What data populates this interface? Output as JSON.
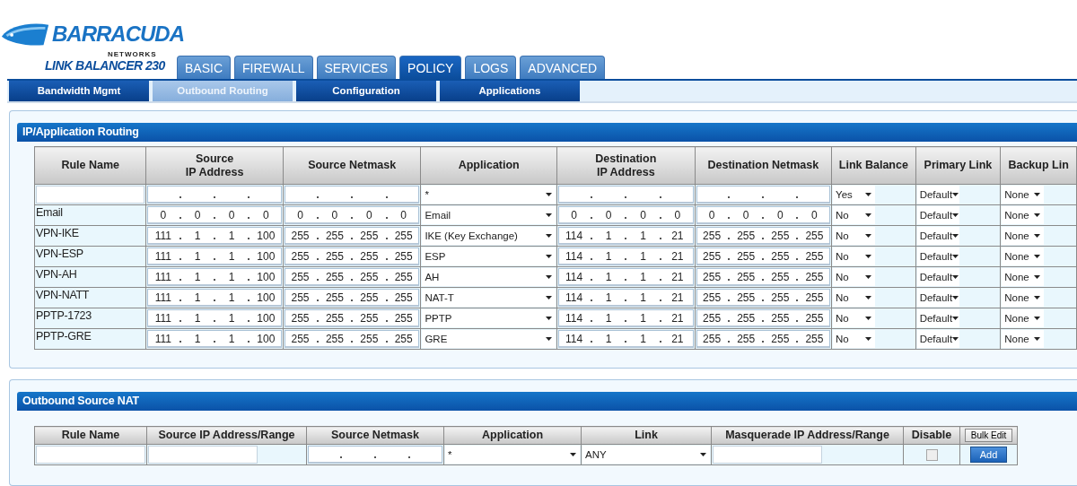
{
  "logo": {
    "brand": "BARRACUDA",
    "tagline": "NETWORKS",
    "product": "LINK BALANCER 230"
  },
  "tabs": [
    {
      "label": "BASIC",
      "selected": false
    },
    {
      "label": "FIREWALL",
      "selected": false
    },
    {
      "label": "SERVICES",
      "selected": false
    },
    {
      "label": "POLICY",
      "selected": true
    },
    {
      "label": "LOGS",
      "selected": false
    },
    {
      "label": "ADVANCED",
      "selected": false
    }
  ],
  "subtabs": [
    {
      "label": "Bandwidth Mgmt",
      "selected": false
    },
    {
      "label": "Outbound Routing",
      "selected": true
    },
    {
      "label": "Configuration",
      "selected": false
    },
    {
      "label": "Applications",
      "selected": false
    }
  ],
  "routing": {
    "title": "IP/Application Routing",
    "columns": [
      {
        "label": "Rule Name",
        "kind": "text"
      },
      {
        "label": "Source\nIP Address",
        "kind": "ip"
      },
      {
        "label": "Source Netmask",
        "kind": "ip"
      },
      {
        "label": "Application",
        "kind": "select"
      },
      {
        "label": "Destination\nIP Address",
        "kind": "ip"
      },
      {
        "label": "Destination Netmask",
        "kind": "ip"
      },
      {
        "label": "Link Balance",
        "kind": "select-short"
      },
      {
        "label": "Primary Link",
        "kind": "select-short"
      },
      {
        "label": "Backup Lin",
        "kind": "select-short"
      }
    ],
    "rows": [
      {
        "cells": [
          null,
          null,
          null,
          "*",
          null,
          null,
          "Yes",
          "Default",
          "None"
        ]
      },
      {
        "cells": [
          "Email",
          [
            "0",
            "0",
            "0",
            "0"
          ],
          [
            "0",
            "0",
            "0",
            "0"
          ],
          "Email",
          [
            "0",
            "0",
            "0",
            "0"
          ],
          [
            "0",
            "0",
            "0",
            "0"
          ],
          "No",
          "Default",
          "None"
        ]
      },
      {
        "cells": [
          "VPN-IKE",
          [
            "111",
            "1",
            "1",
            "100"
          ],
          [
            "255",
            "255",
            "255",
            "255"
          ],
          "IKE (Key Exchange)",
          [
            "114",
            "1",
            "1",
            "21"
          ],
          [
            "255",
            "255",
            "255",
            "255"
          ],
          "No",
          "Default",
          "None"
        ]
      },
      {
        "cells": [
          "VPN-ESP",
          [
            "111",
            "1",
            "1",
            "100"
          ],
          [
            "255",
            "255",
            "255",
            "255"
          ],
          "ESP",
          [
            "114",
            "1",
            "1",
            "21"
          ],
          [
            "255",
            "255",
            "255",
            "255"
          ],
          "No",
          "Default",
          "None"
        ]
      },
      {
        "cells": [
          "VPN-AH",
          [
            "111",
            "1",
            "1",
            "100"
          ],
          [
            "255",
            "255",
            "255",
            "255"
          ],
          "AH",
          [
            "114",
            "1",
            "1",
            "21"
          ],
          [
            "255",
            "255",
            "255",
            "255"
          ],
          "No",
          "Default",
          "None"
        ]
      },
      {
        "cells": [
          "VPN-NATT",
          [
            "111",
            "1",
            "1",
            "100"
          ],
          [
            "255",
            "255",
            "255",
            "255"
          ],
          "NAT-T",
          [
            "114",
            "1",
            "1",
            "21"
          ],
          [
            "255",
            "255",
            "255",
            "255"
          ],
          "No",
          "Default",
          "None"
        ]
      },
      {
        "cells": [
          "PPTP-1723",
          [
            "111",
            "1",
            "1",
            "100"
          ],
          [
            "255",
            "255",
            "255",
            "255"
          ],
          "PPTP",
          [
            "114",
            "1",
            "1",
            "21"
          ],
          [
            "255",
            "255",
            "255",
            "255"
          ],
          "No",
          "Default",
          "None"
        ]
      },
      {
        "cells": [
          "PPTP-GRE",
          [
            "111",
            "1",
            "1",
            "100"
          ],
          [
            "255",
            "255",
            "255",
            "255"
          ],
          "GRE",
          [
            "114",
            "1",
            "1",
            "21"
          ],
          [
            "255",
            "255",
            "255",
            "255"
          ],
          "No",
          "Default",
          "None"
        ]
      }
    ]
  },
  "nat": {
    "title": "Outbound Source NAT",
    "columns": [
      {
        "label": "Rule Name",
        "kind": "input"
      },
      {
        "label": "Source IP Address/Range",
        "kind": "input-short"
      },
      {
        "label": "Source Netmask",
        "kind": "ip"
      },
      {
        "label": "Application",
        "kind": "select"
      },
      {
        "label": "Link",
        "kind": "select"
      },
      {
        "label": "Masquerade IP Address/Range",
        "kind": "input-short"
      },
      {
        "label": "Disable",
        "kind": "checkbox"
      },
      {
        "button": "Bulk Edit",
        "kind": "button"
      }
    ],
    "rows": [
      {
        "cells": [
          null,
          null,
          null,
          "*",
          "ANY",
          null,
          {
            "checked": false
          },
          "Add"
        ]
      }
    ]
  }
}
